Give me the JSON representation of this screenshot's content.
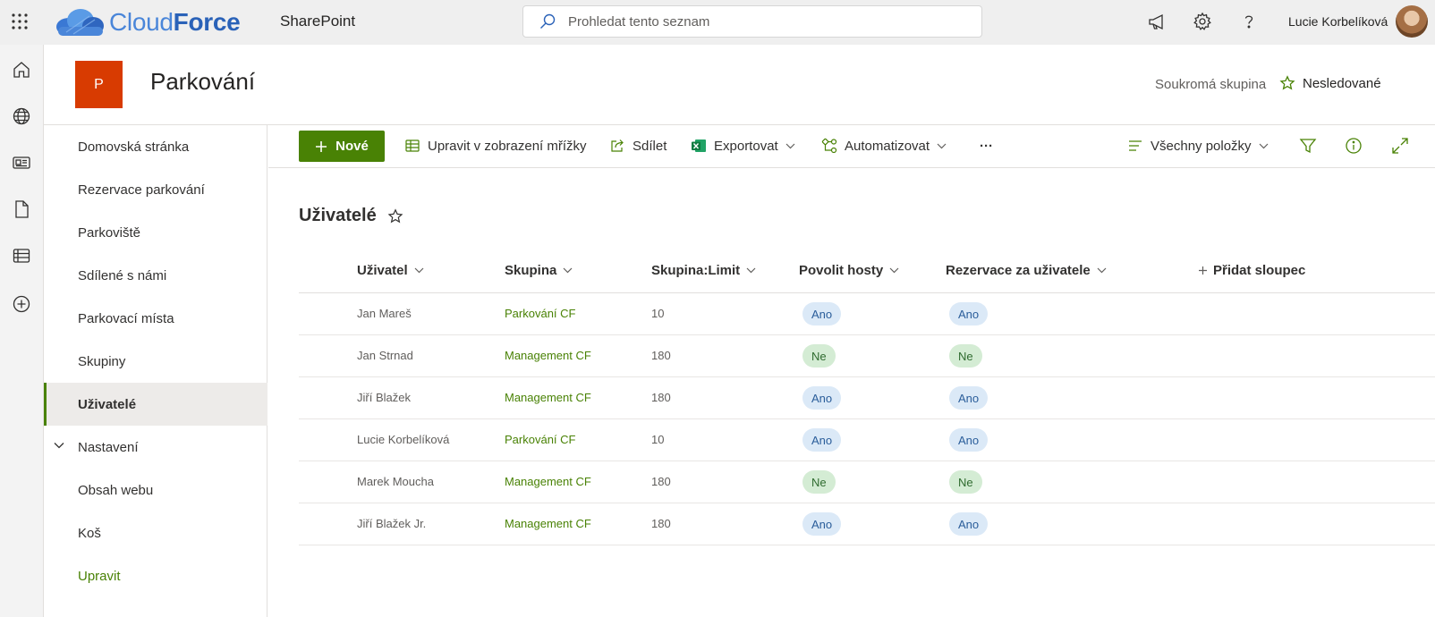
{
  "suite": {
    "brand_part1": "Cloud",
    "brand_part2": "Force",
    "app_name": "SharePoint",
    "search_placeholder": "Prohledat tento seznam",
    "user_name": "Lucie Korbelíková"
  },
  "site": {
    "logo_letter": "P",
    "title": "Parkování",
    "privacy": "Soukromá skupina",
    "follow_label": "Nesledované"
  },
  "nav": {
    "items": [
      "Domovská stránka",
      "Rezervace parkování",
      "Parkoviště",
      "Sdílené s námi",
      "Parkovací místa",
      "Skupiny",
      "Uživatelé",
      "Nastavení",
      "Obsah webu",
      "Koš",
      "Upravit"
    ],
    "active_index": 6
  },
  "commands": {
    "new": "Nové",
    "edit_grid": "Upravit v zobrazení mřížky",
    "share": "Sdílet",
    "export": "Exportovat",
    "automate": "Automatizovat",
    "more": "···",
    "view": "Všechny položky"
  },
  "list": {
    "title": "Uživatelé",
    "columns": [
      "Uživatel",
      "Skupina",
      "Skupina:Limit",
      "Povolit hosty",
      "Rezervace za uživatele"
    ],
    "add_column": "Přidat sloupec",
    "rows": [
      {
        "user": "Jan Mareš",
        "group": "Parkování CF",
        "limit": "10",
        "guests": "Ano",
        "reserve": "Ano"
      },
      {
        "user": "Jan Strnad",
        "group": "Management CF",
        "limit": "180",
        "guests": "Ne",
        "reserve": "Ne"
      },
      {
        "user": "Jiří Blažek",
        "group": "Management CF",
        "limit": "180",
        "guests": "Ano",
        "reserve": "Ano"
      },
      {
        "user": "Lucie Korbelíková",
        "group": "Parkování CF",
        "limit": "10",
        "guests": "Ano",
        "reserve": "Ano"
      },
      {
        "user": "Marek Moucha",
        "group": "Management CF",
        "limit": "180",
        "guests": "Ne",
        "reserve": "Ne"
      },
      {
        "user": "Jiří Blažek Jr.",
        "group": "Management CF",
        "limit": "180",
        "guests": "Ano",
        "reserve": "Ano"
      }
    ]
  },
  "colors": {
    "accent_green": "#498205",
    "site_logo": "#d83b01",
    "pill_yes_bg": "#dbe9f7",
    "pill_no_bg": "#d4ecd4"
  }
}
